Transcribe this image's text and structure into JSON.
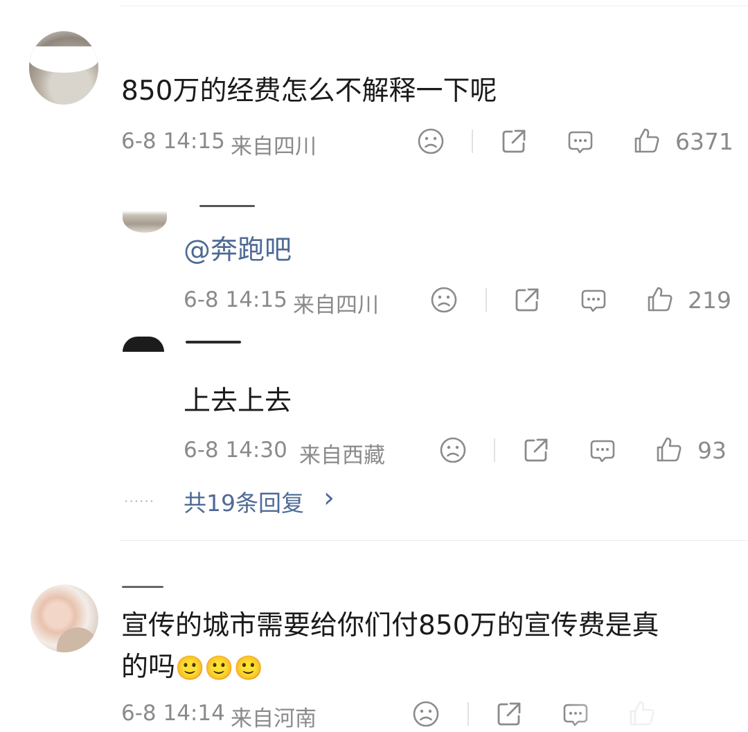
{
  "comments": [
    {
      "text": "850万的经费怎么不解释一下呢",
      "time": "6-8 14:15",
      "location": "来自四川",
      "likes": "6371"
    },
    {
      "text": "宣传的城市需要给你们付850万的宣传费是真",
      "text_line2": "的吗",
      "emoji": [
        "🙂",
        "🙂",
        "🙂"
      ],
      "time": "6-8 14:14",
      "location": "来自河南"
    }
  ],
  "replies": [
    {
      "mention": "@奔跑吧",
      "time": "6-8 14:15",
      "location": "来自四川",
      "likes": "219"
    },
    {
      "text": "上去上去",
      "time": "6-8 14:30",
      "location": "来自西藏",
      "likes": "93"
    }
  ],
  "more_replies": {
    "dots": "······",
    "label": "共19条回复",
    "chevron": "›"
  },
  "icons": {
    "dislike": "sad-face-icon",
    "share": "share-icon",
    "comment": "comment-icon",
    "like": "thumbs-up-icon"
  },
  "colors": {
    "meta_gray": "#8a8a8a",
    "link_blue": "#4e6a95"
  }
}
